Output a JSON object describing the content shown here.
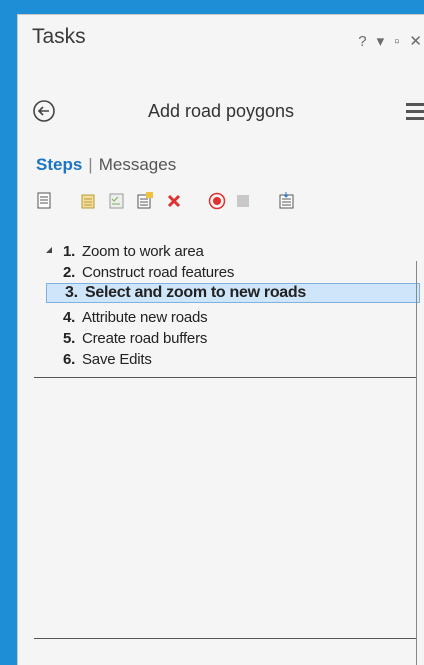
{
  "pane": {
    "title": "Tasks",
    "help_label": "?",
    "dropdown_label": "▾",
    "restore_label": "▫",
    "close_label": "✕"
  },
  "task": {
    "name": "Add road poygons"
  },
  "tabs": {
    "steps": "Steps",
    "separator": "|",
    "messages": "Messages"
  },
  "toolbar": {
    "tools": [
      "open-task-icon",
      "new-task-icon",
      "edit-step-icon",
      "step-properties-icon",
      "delete-icon",
      "record-icon",
      "stop-icon",
      "export-icon"
    ]
  },
  "steps": [
    {
      "number": "1.",
      "label": "Zoom to work area"
    },
    {
      "number": "2.",
      "label": "Construct road features"
    },
    {
      "number": "3.",
      "label": "Select and zoom to new roads"
    },
    {
      "number": "4.",
      "label": "Attribute new roads"
    },
    {
      "number": "5.",
      "label": "Create road buffers"
    },
    {
      "number": "6.",
      "label": "Save Edits"
    }
  ],
  "colors": {
    "accent": "#1b73c2",
    "selection_fill": "#cfe5fa",
    "selection_border": "#7fb2e1",
    "desktop": "#1e8fd6",
    "delete": "#e03030"
  }
}
